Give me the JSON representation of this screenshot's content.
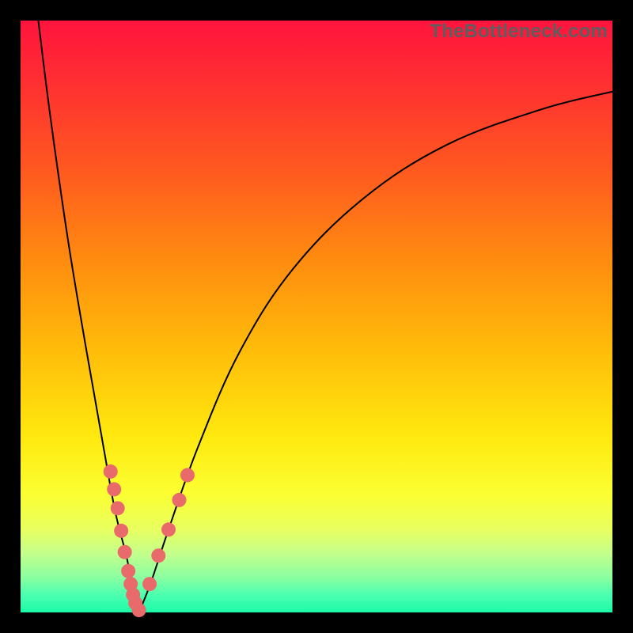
{
  "watermark": "TheBottleneck.com",
  "colors": {
    "frame": "#000000",
    "curve": "#000000",
    "marker": "#e86a6a",
    "gradient_stops": [
      "#ff143e",
      "#ff5820",
      "#ffba0a",
      "#ffe80e",
      "#e8ff60",
      "#1cfaa8"
    ]
  },
  "chart_data": {
    "type": "line",
    "title": "",
    "xlabel": "",
    "ylabel": "",
    "xlim": [
      0,
      100
    ],
    "ylim": [
      0,
      100
    ],
    "grid": false,
    "note": "No numeric axes are rendered; values are relative percentages of the plot area. Two curves form a V with minimum near x≈20; salmon markers cluster near the trough.",
    "series": [
      {
        "name": "left-curve",
        "x": [
          3,
          5,
          8,
          11,
          14,
          16,
          18,
          19,
          20
        ],
        "y": [
          100,
          84,
          63,
          45,
          28,
          17,
          9,
          3,
          0
        ]
      },
      {
        "name": "right-curve",
        "x": [
          20,
          22,
          25,
          30,
          37,
          46,
          58,
          72,
          88,
          100
        ],
        "y": [
          0,
          5,
          14,
          28,
          44,
          58,
          70,
          79,
          85,
          88
        ]
      }
    ],
    "markers": [
      {
        "x": 15.2,
        "y": 23.8
      },
      {
        "x": 15.8,
        "y": 20.8
      },
      {
        "x": 16.4,
        "y": 17.6
      },
      {
        "x": 17.0,
        "y": 13.8
      },
      {
        "x": 17.6,
        "y": 10.2
      },
      {
        "x": 18.2,
        "y": 7.0
      },
      {
        "x": 18.6,
        "y": 4.8
      },
      {
        "x": 19.0,
        "y": 3.0
      },
      {
        "x": 19.4,
        "y": 1.6
      },
      {
        "x": 20.0,
        "y": 0.4
      },
      {
        "x": 21.8,
        "y": 4.8
      },
      {
        "x": 23.3,
        "y": 9.6
      },
      {
        "x": 25.0,
        "y": 14.0
      },
      {
        "x": 26.8,
        "y": 19.0
      },
      {
        "x": 28.2,
        "y": 23.2
      }
    ]
  }
}
